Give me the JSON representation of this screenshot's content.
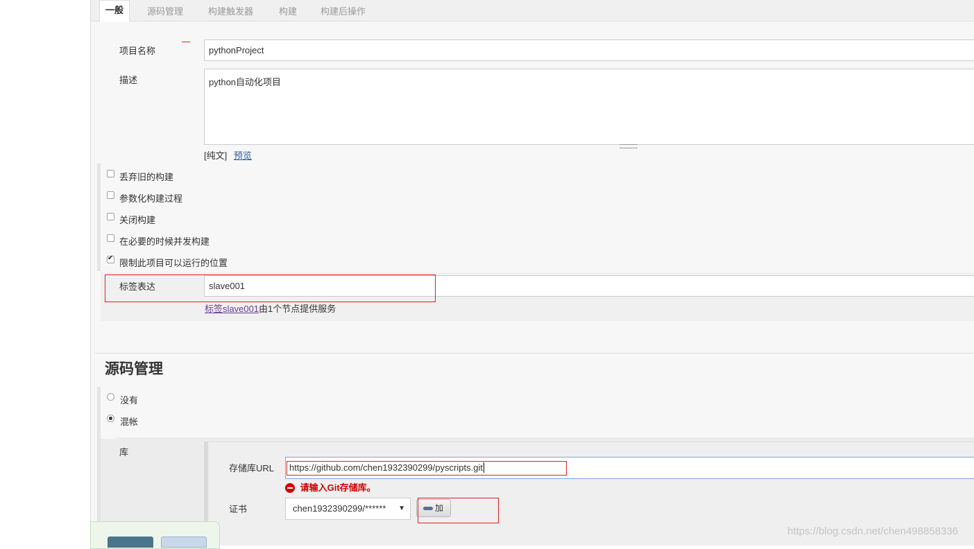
{
  "tabs": [
    "一般",
    "源码管理",
    "构建触发器",
    "构建",
    "构建后操作"
  ],
  "general": {
    "project_name_label": "项目名称",
    "project_name_value": "pythonProject",
    "description_label": "描述",
    "description_value": "python自动化项目",
    "plain_text": "[纯文]",
    "preview": "预览",
    "options": [
      {
        "label": "丢弃旧的构建",
        "checked": false
      },
      {
        "label": "参数化构建过程",
        "checked": false
      },
      {
        "label": "关闭构建",
        "checked": false
      },
      {
        "label": "在必要的时候并发构建",
        "checked": false
      },
      {
        "label": "限制此项目可以运行的位置",
        "checked": true
      }
    ],
    "label_expr_label": "标签表达",
    "label_expr_value": "slave001",
    "label_hint_link": "标签slave001",
    "label_hint_text": "由1个节点提供服务"
  },
  "scm": {
    "heading": "源码管理",
    "options": [
      {
        "label": "没有",
        "checked": false
      },
      {
        "label": "混帐",
        "checked": true
      }
    ],
    "repo_label": "库",
    "repo_url_label": "存储库URL",
    "repo_url_value": "https://github.com/chen1932390299/pyscripts.git",
    "error_text": "请输入Git存储库。",
    "credentials_label": "证书",
    "credentials_value": "chen1932390299/******",
    "add_button": "加"
  },
  "watermark": "https://blog.csdn.net/chen498858336",
  "colors": {
    "error": "#d00000",
    "annotation": "#e02020",
    "link": "#2c5dab"
  }
}
